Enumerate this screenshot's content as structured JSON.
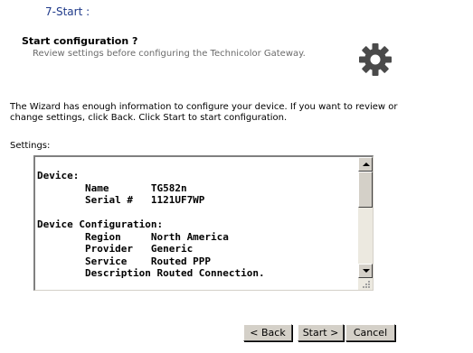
{
  "step": {
    "title": "7-Start :"
  },
  "header": {
    "title": "Start configuration ?",
    "subtitle": "Review settings before configuring the Technicolor Gateway."
  },
  "intro_text": "The Wizard has enough information to configure your device. If you want to review or change settings, click Back. Click Start to start configuration.",
  "settings": {
    "label": "Settings:",
    "content": "Device:\n        Name       TG582n\n        Serial #   1121UF7WP\n\nDevice Configuration:\n        Region     North America\n        Provider   Generic\n        Service    Routed PPP\n        Description Routed Connection.\n"
  },
  "buttons": {
    "back": "< Back",
    "start": "Start >",
    "cancel": "Cancel"
  },
  "icons": {
    "gear": "gear-icon",
    "scroll_up": "arrow-up-icon",
    "scroll_down": "arrow-down-icon",
    "resize": "resize-grip-icon"
  }
}
